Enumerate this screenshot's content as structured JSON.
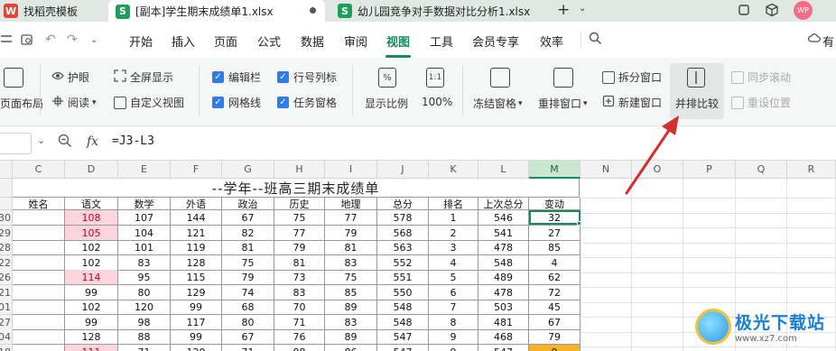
{
  "tabs": [
    {
      "icon": "W",
      "label": "找稻壳模板"
    },
    {
      "icon": "S",
      "label": "[副本]学生期末成绩单1.xlsx"
    },
    {
      "icon": "S",
      "label": "幼儿园竞争对手数据对比分析1.xlsx"
    }
  ],
  "avatar_text": "WP",
  "menu": [
    "开始",
    "插入",
    "页面",
    "公式",
    "数据",
    "审阅",
    "视图",
    "工具",
    "会员专享",
    "效率"
  ],
  "menu_active": "视图",
  "menu_right": "有",
  "ribbon": {
    "page_layout": "页面布局",
    "eye_protect": "护眼",
    "reading": "阅读",
    "fullscreen": "全屏显示",
    "custom_view": "自定义视图",
    "edit_bar": "编辑栏",
    "gridlines": "网格线",
    "row_col_headers": "行号列标",
    "task_pane": "任务窗格",
    "display_ratio": "显示比例",
    "hundred": "100%",
    "ratio_icon": "%",
    "onetoone_icon": "1:1",
    "freeze": "冻结窗格",
    "rearrange": "重排窗口",
    "split": "拆分窗口",
    "new_window": "新建窗口",
    "side_by_side": "并排比较",
    "sync_scroll": "同步滚动",
    "reset_position": "重设位置"
  },
  "formula": "=J3-L3",
  "fx_label": "fx",
  "columns": [
    "C",
    "D",
    "E",
    "F",
    "G",
    "H",
    "I",
    "J",
    "K",
    "L",
    "M",
    "N",
    "O",
    "P",
    "Q",
    "R"
  ],
  "selected_column": "M",
  "sheet_title": "--学年--班高三期末成绩单",
  "table_headers": [
    "姓名",
    "语文",
    "数学",
    "外语",
    "政治",
    "历史",
    "地理",
    "总分",
    "排名",
    "上次总分",
    "变动"
  ],
  "rows": [
    {
      "rowno": "30",
      "name": "",
      "yuwen": "108",
      "shuxue": "107",
      "waiyu": "144",
      "zhengzhi": "67",
      "lishi": "75",
      "dili": "77",
      "zongfen": "578",
      "paiming": "1",
      "shangci": "546",
      "biandong": "32",
      "pink": true
    },
    {
      "rowno": "29",
      "name": "",
      "yuwen": "105",
      "shuxue": "104",
      "waiyu": "121",
      "zhengzhi": "82",
      "lishi": "77",
      "dili": "79",
      "zongfen": "568",
      "paiming": "2",
      "shangci": "541",
      "biandong": "27",
      "pink": true
    },
    {
      "rowno": "28",
      "name": "",
      "yuwen": "102",
      "shuxue": "101",
      "waiyu": "119",
      "zhengzhi": "81",
      "lishi": "79",
      "dili": "81",
      "zongfen": "563",
      "paiming": "3",
      "shangci": "478",
      "biandong": "85",
      "pink": false
    },
    {
      "rowno": "22",
      "name": "",
      "yuwen": "102",
      "shuxue": "83",
      "waiyu": "128",
      "zhengzhi": "75",
      "lishi": "81",
      "dili": "83",
      "zongfen": "552",
      "paiming": "4",
      "shangci": "548",
      "biandong": "4",
      "pink": false
    },
    {
      "rowno": "26",
      "name": "",
      "yuwen": "114",
      "shuxue": "95",
      "waiyu": "115",
      "zhengzhi": "79",
      "lishi": "73",
      "dili": "75",
      "zongfen": "551",
      "paiming": "5",
      "shangci": "489",
      "biandong": "62",
      "pink": true
    },
    {
      "rowno": "21",
      "name": "",
      "yuwen": "99",
      "shuxue": "80",
      "waiyu": "129",
      "zhengzhi": "74",
      "lishi": "83",
      "dili": "85",
      "zongfen": "550",
      "paiming": "6",
      "shangci": "478",
      "biandong": "72",
      "pink": false
    },
    {
      "rowno": "01",
      "name": "",
      "yuwen": "102",
      "shuxue": "120",
      "waiyu": "99",
      "zhengzhi": "68",
      "lishi": "70",
      "dili": "89",
      "zongfen": "548",
      "paiming": "7",
      "shangci": "503",
      "biandong": "45",
      "pink": false
    },
    {
      "rowno": "27",
      "name": "",
      "yuwen": "99",
      "shuxue": "98",
      "waiyu": "117",
      "zhengzhi": "80",
      "lishi": "71",
      "dili": "83",
      "zongfen": "548",
      "paiming": "8",
      "shangci": "481",
      "biandong": "67",
      "pink": false
    },
    {
      "rowno": "04",
      "name": "",
      "yuwen": "128",
      "shuxue": "88",
      "waiyu": "99",
      "zhengzhi": "67",
      "lishi": "76",
      "dili": "89",
      "zongfen": "547",
      "paiming": "9",
      "shangci": "468",
      "biandong": "79",
      "pink": false
    },
    {
      "rowno": "18",
      "name": "",
      "yuwen": "111",
      "shuxue": "71",
      "waiyu": "120",
      "zhengzhi": "71",
      "lishi": "88",
      "dili": "86",
      "zongfen": "547",
      "paiming": "9",
      "shangci": "547",
      "biandong": "0",
      "pink": true
    }
  ],
  "watermark": {
    "main": "极光下载站",
    "sub": "www.xz7.com"
  },
  "colors": {
    "accent": "#1a8a5a",
    "pink_cell": "#fcd5dc",
    "arrow": "#d32f2f",
    "highlight_orange": "#f6b32a"
  }
}
